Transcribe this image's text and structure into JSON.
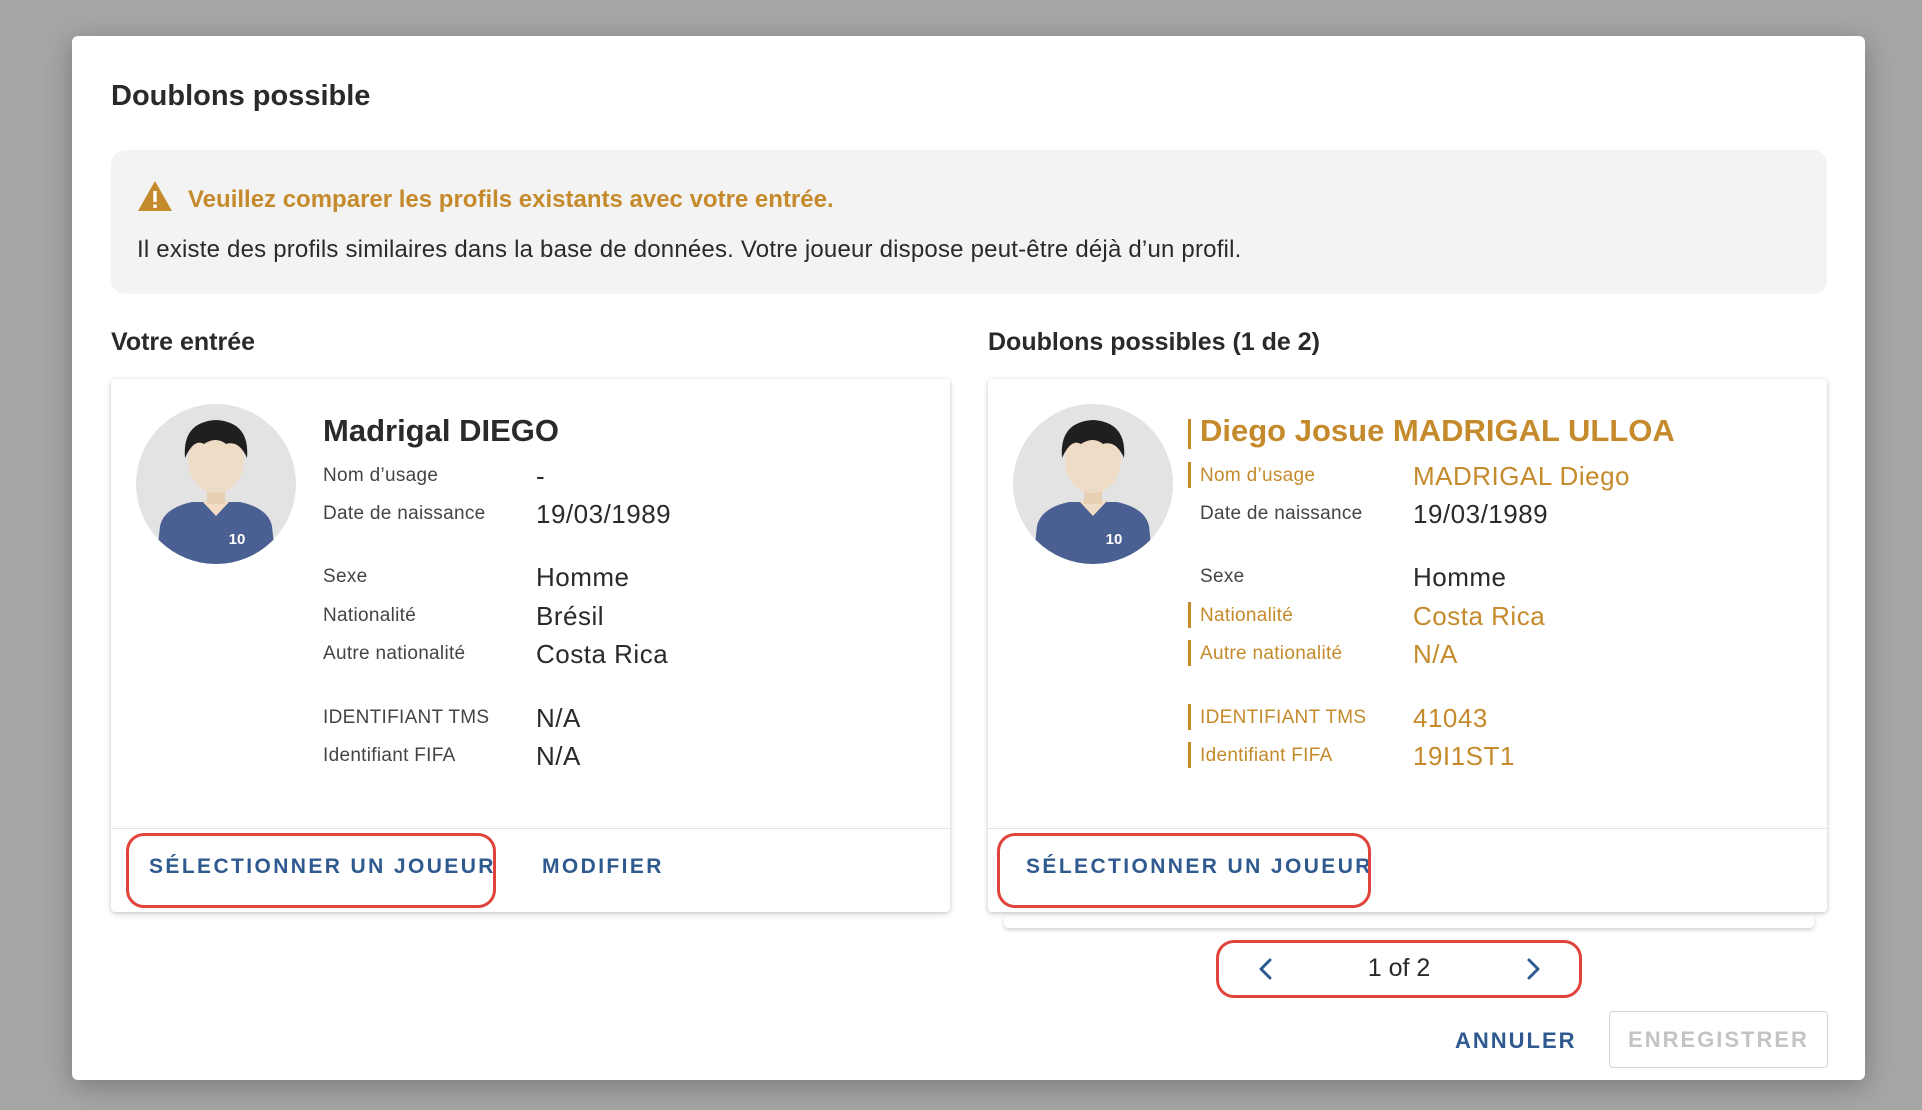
{
  "dialog": {
    "title": "Doublons possible",
    "alert": {
      "title": "Veuillez comparer les profils existants avec votre entrée.",
      "text": "Il existe des profils similaires dans la base de données. Votre joueur dispose peut-être déjà d’un profil."
    }
  },
  "left": {
    "section_title": "Votre entrée",
    "avatar_number": "10",
    "name": "Madrigal DIEGO",
    "fields": [
      {
        "label": "Nom d’usage",
        "value": "-"
      },
      {
        "label": "Date de naissance",
        "value": "19/03/1989"
      },
      {
        "label": "Sexe",
        "value": "Homme"
      },
      {
        "label": "Nationalité",
        "value": "Brésil"
      },
      {
        "label": "Autre nationalité",
        "value": "Costa Rica"
      },
      {
        "label": "IDENTIFIANT TMS",
        "value": "N/A"
      },
      {
        "label": "Identifiant FIFA",
        "value": "N/A"
      }
    ],
    "select_label": "SÉLECTIONNER UN JOUEUR",
    "modify_label": "MODIFIER"
  },
  "right": {
    "section_title": "Doublons possibles (1 de 2)",
    "avatar_number": "10",
    "name": "Diego Josue MADRIGAL ULLOA",
    "fields": [
      {
        "label": "Nom d’usage",
        "value": "MADRIGAL Diego"
      },
      {
        "label": "Date de naissance",
        "value": "19/03/1989"
      },
      {
        "label": "Sexe",
        "value": "Homme"
      },
      {
        "label": "Nationalité",
        "value": "Costa Rica"
      },
      {
        "label": "Autre nationalité",
        "value": "N/A"
      },
      {
        "label": "IDENTIFIANT TMS",
        "value": "41043"
      },
      {
        "label": "Identifiant FIFA",
        "value": "19I1ST1"
      }
    ],
    "select_label": "SÉLECTIONNER UN JOUEUR"
  },
  "pager": {
    "text": "1 of 2"
  },
  "footer": {
    "cancel_label": "ANNULER",
    "save_label": "ENREGISTRER"
  },
  "colors": {
    "accent": "#2f5a8f",
    "difference": "#c58a2b",
    "highlight": "#e0433a"
  }
}
